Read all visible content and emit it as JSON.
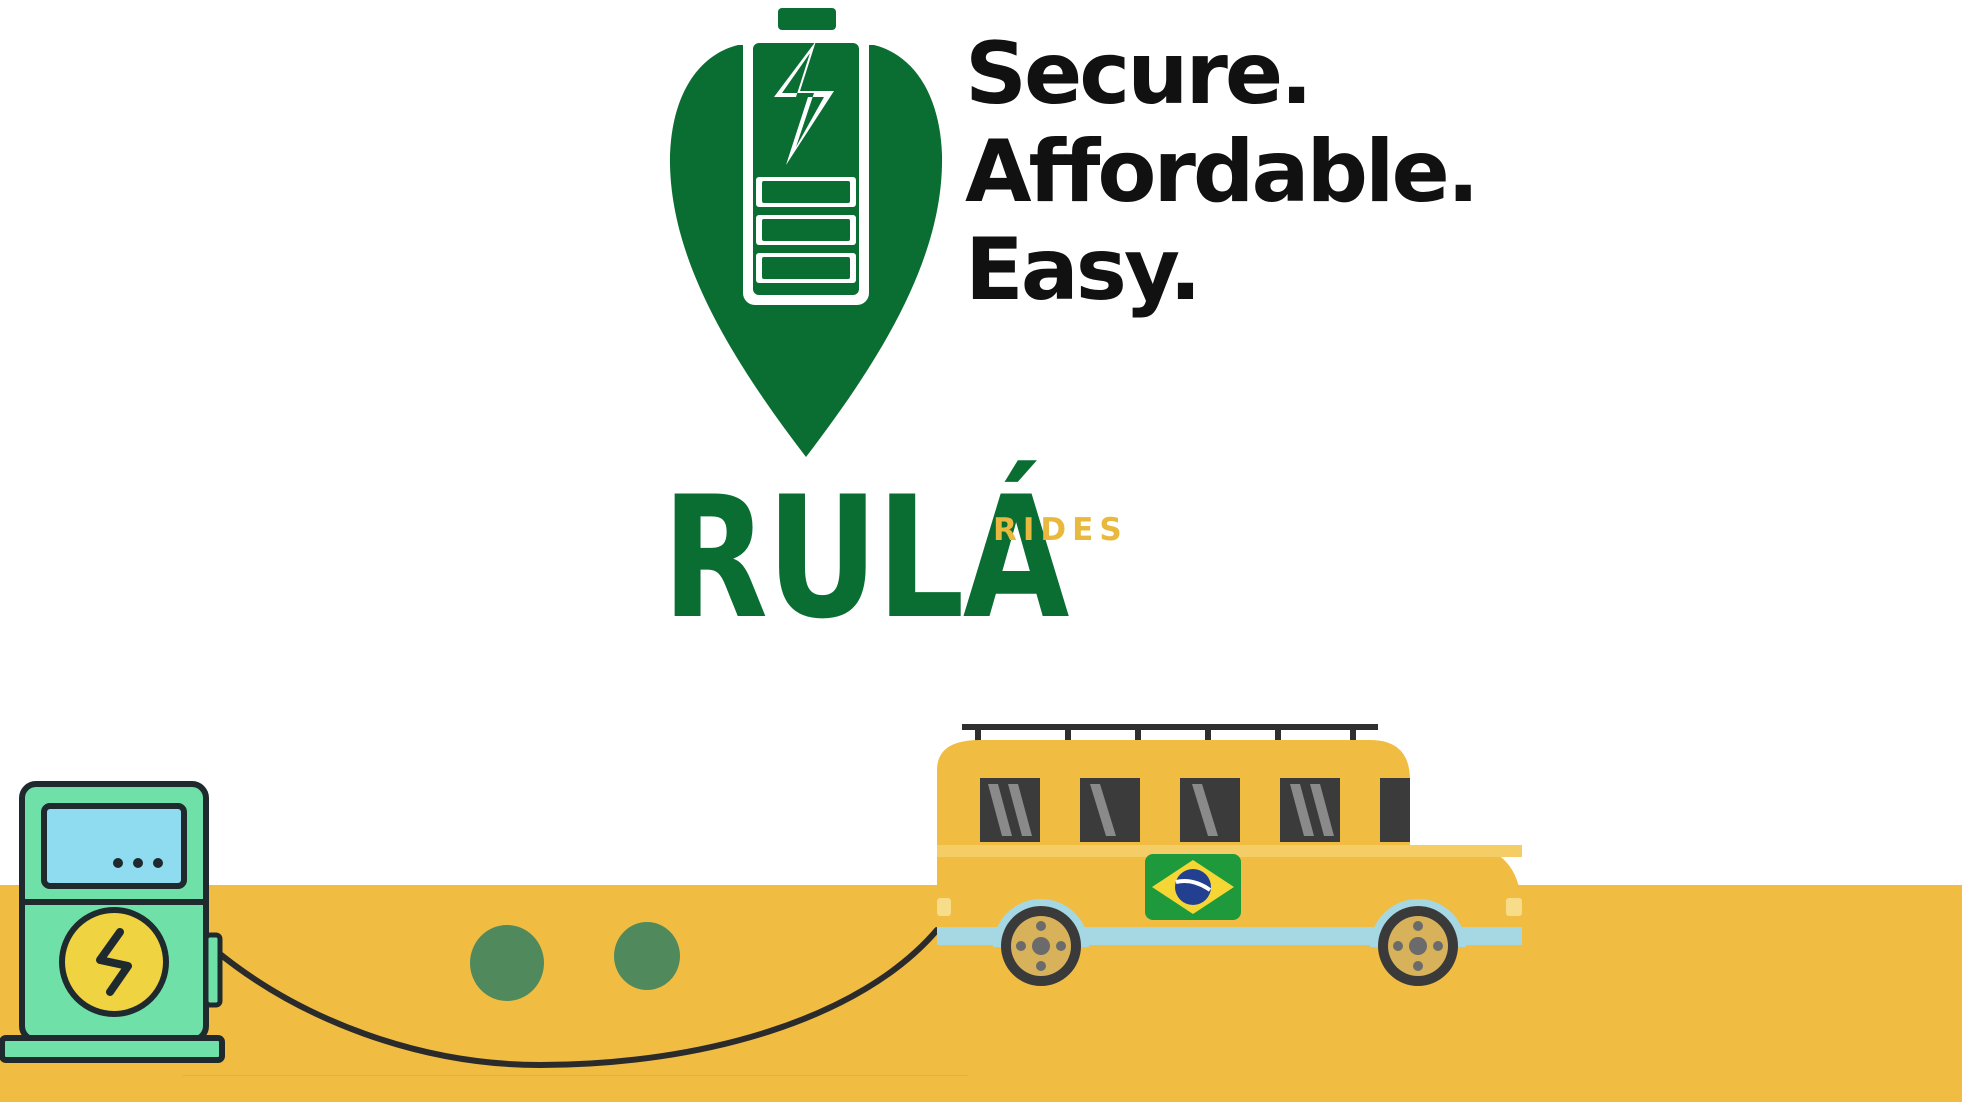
{
  "tagline": [
    "Secure.",
    "Affordable.",
    "Easy."
  ],
  "brand": {
    "name": "RULÁ",
    "sub": "RIDES"
  },
  "colors": {
    "brand_green": "#0a6e33",
    "accent_yellow": "#f0bd42",
    "station_green": "#6fe1a8",
    "screen_blue": "#8fdcf0"
  },
  "icons": [
    "battery-pin-icon",
    "lightning-bolt-icon",
    "charging-station-icon",
    "bus-icon",
    "brazil-flag-icon"
  ]
}
